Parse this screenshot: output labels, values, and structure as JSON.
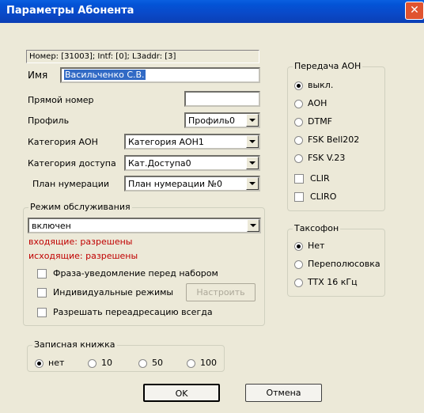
{
  "window": {
    "title": "Параметры Абонента",
    "close_glyph": "✕"
  },
  "info_line": "Номер: [31003]; Intf: [0]; L3addr: [3]",
  "name": {
    "label": "Имя",
    "value": "Васильченко С.В."
  },
  "direct_number": {
    "label": "Прямой номер",
    "value": ""
  },
  "profile": {
    "label": "Профиль",
    "value": "Профиль0"
  },
  "aon_category": {
    "label": "Категория АОН",
    "value": "Категория АОН1"
  },
  "access_category": {
    "label": "Категория доступа",
    "value": "Кат.Доступа0"
  },
  "numbering_plan": {
    "label": "План нумерации",
    "value": "План нумерации №0"
  },
  "service_mode": {
    "label": "Режим обслуживания",
    "value": "включен",
    "incoming": "входящие: разрешены",
    "outgoing": "исходящие: разрешены",
    "checkboxes": [
      {
        "label": "Фраза-уведомление перед набором",
        "checked": false
      },
      {
        "label": "Индивидуальные режимы",
        "checked": false
      },
      {
        "label": "Разрешать переадресацию всегда",
        "checked": false
      }
    ],
    "setup_button": "Настроить"
  },
  "aon_transfer": {
    "label": "Передача АОН",
    "radios": [
      {
        "label": "выкл.",
        "checked": true
      },
      {
        "label": "АОН",
        "checked": false
      },
      {
        "label": "DTMF",
        "checked": false
      },
      {
        "label": "FSK Bell202",
        "checked": false
      },
      {
        "label": "FSK V.23",
        "checked": false
      }
    ],
    "checkboxes": [
      {
        "label": "CLIR",
        "checked": false
      },
      {
        "label": "CLIRO",
        "checked": false
      }
    ]
  },
  "payphone": {
    "label": "Таксофон",
    "radios": [
      {
        "label": "Нет",
        "checked": true
      },
      {
        "label": "Переполюсовка",
        "checked": false
      },
      {
        "label": "TTX 16 кГц",
        "checked": false
      }
    ]
  },
  "notebook": {
    "label": "Записная книжка",
    "radios": [
      {
        "label": "нет",
        "checked": true
      },
      {
        "label": "10",
        "checked": false
      },
      {
        "label": "50",
        "checked": false
      },
      {
        "label": "100",
        "checked": false
      }
    ]
  },
  "buttons": {
    "ok": "OK",
    "cancel": "Отмена"
  }
}
